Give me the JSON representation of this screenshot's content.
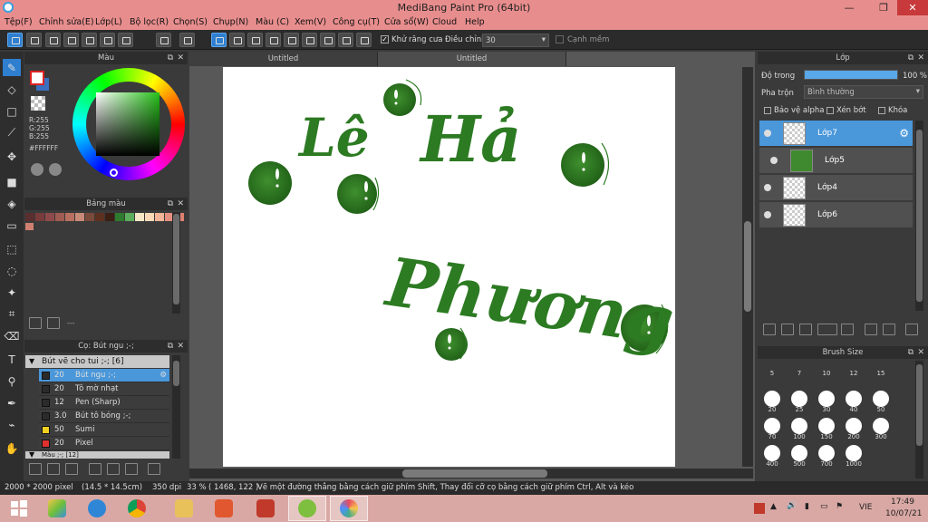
{
  "window": {
    "title": "MediBang Paint Pro (64bit)",
    "minimize": "—",
    "maximize": "❐",
    "close": "✕"
  },
  "menu": [
    "Tệp(F)",
    "Chỉnh sửa(E)",
    "Lớp(L)",
    "Bộ lọc(R)",
    "Chọn(S)",
    "Chụp(N)",
    "Màu (C)",
    "Xem(V)",
    "Công cụ(T)",
    "Cửa sổ(W)",
    "Cloud",
    "Help"
  ],
  "toolbar": {
    "antialias_label": "Khử răng cưa",
    "antialias_checked": true,
    "correction_label": "Điều chỉnh",
    "correction_value": "30",
    "snap_label": "Cạnh mềm",
    "icons": [
      "stabilizer-icon",
      "export-icon",
      "speech-icon",
      "comment-icon",
      "document-icon",
      "list-icon",
      "grid-icon",
      "undo-icon",
      "redo-icon",
      "no-snap-icon",
      "parallel-snap-icon",
      "grid-snap-icon",
      "vanish-snap-icon",
      "radial-snap-icon",
      "circle-snap-icon",
      "curve-snap-icon",
      "ring-snap-icon",
      "settings-snap-icon"
    ]
  },
  "tools": [
    "brush-tool",
    "eraser-tool",
    "rect-tool",
    "dot-tool",
    "move-tool",
    "fill-rect-tool",
    "bucket-tool",
    "gradient-tool",
    "select-rect-tool",
    "lasso-tool",
    "magic-wand-tool",
    "select-pen-tool",
    "select-eraser-tool",
    "text-tool",
    "divide-tool",
    "eyedropper-tool",
    "hand-tool"
  ],
  "color_panel": {
    "title": "Màu",
    "r": "R:255",
    "g": "G:255",
    "b": "B:255",
    "hex": "#FFFFFF"
  },
  "palette_panel": {
    "title": "Bảng màu",
    "swatches": [
      "#5a2e2e",
      "#7a3b3b",
      "#8e4a4a",
      "#a05c52",
      "#b86f60",
      "#c98a78",
      "#7a4a3a",
      "#5e3020",
      "#3b1e14",
      "#2e7a2e",
      "#5cae5c",
      "#f6e7c6",
      "#fbd9b6",
      "#f4b497",
      "#e89080",
      "#e08070"
    ],
    "footer_text": "---"
  },
  "brush_panel": {
    "title": "Cọ: Bút ngu ;-;",
    "group1": "Bút vẽ cho tui ;-; [6]",
    "group2": "Màu ;-; [12]",
    "items": [
      {
        "size": "20",
        "name": "Bút ngu ;-;",
        "color": "#2b2b2b",
        "selected": true
      },
      {
        "size": "20",
        "name": "Tô mờ nhạt",
        "color": "#2b2b2b",
        "selected": false
      },
      {
        "size": "12",
        "name": "Pen (Sharp)",
        "color": "#2b2b2b",
        "selected": false
      },
      {
        "size": "3.0",
        "name": "Bút tô bóng ;-;",
        "color": "#2b2b2b",
        "selected": false
      },
      {
        "size": "50",
        "name": "Sumi",
        "color": "#f0d020",
        "selected": false
      },
      {
        "size": "20",
        "name": "Pixel",
        "color": "#e03030",
        "selected": false
      }
    ]
  },
  "document_tabs": [
    "Untitled",
    "Untitled"
  ],
  "canvas_art": {
    "text_le": "Lê",
    "text_ha": "Hả",
    "text_phuong": "Phương",
    "ink_color": "#2c7a22"
  },
  "layer_panel": {
    "title": "Lớp",
    "opacity_label": "Độ trong",
    "opacity_value": "100 %",
    "opacity_fraction": 1.0,
    "blend_label": "Pha trộn",
    "blend_value": "Bình thường",
    "protect_alpha": "Bảo vệ alpha",
    "clipping": "Xén bớt",
    "lock": "Khóa",
    "layers": [
      {
        "name": "Lớp7",
        "selected": true
      },
      {
        "name": "Lớp5",
        "selected": false
      },
      {
        "name": "Lớp4",
        "selected": false
      },
      {
        "name": "Lớp6",
        "selected": false
      }
    ]
  },
  "brush_size_panel": {
    "title": "Brush Size",
    "sizes": [
      "5",
      "7",
      "10",
      "12",
      "15",
      "20",
      "25",
      "30",
      "40",
      "50",
      "70",
      "100",
      "150",
      "200",
      "300",
      "400",
      "500",
      "700",
      "1000"
    ]
  },
  "status": {
    "size": "2000 * 2000 pixel",
    "cm": "(14.5 * 14.5cm)",
    "dpi": "350 dpi",
    "zoom": "33 %",
    "coords": "( 1468, 122 )",
    "hint": "Vẽ một đường thẳng bằng cách giữ phím Shift, Thay đổi cỡ cọ bằng cách giữ phím Ctrl, Alt và kéo"
  },
  "taskbar": {
    "time": "17:49",
    "date": "10/07/21",
    "lang": "VIE"
  }
}
